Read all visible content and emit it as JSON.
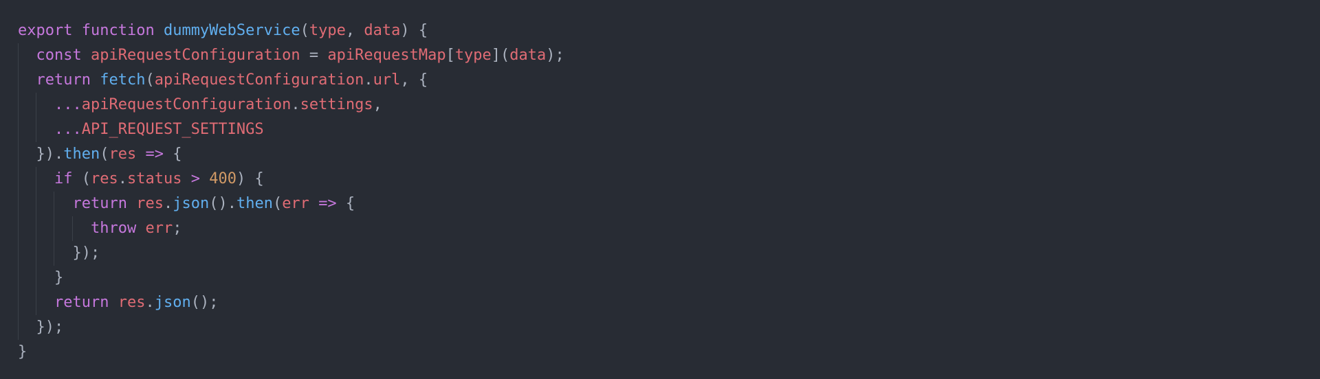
{
  "theme": {
    "background": "#282c34",
    "keyword": "#c678dd",
    "function": "#61afef",
    "variable": "#e06c75",
    "number": "#d19a66",
    "punctuation": "#abb2bf",
    "indent_guide": "#3b4048"
  },
  "code": {
    "lines": [
      {
        "indent": 0,
        "tokens": [
          {
            "t": "export",
            "c": "keyword"
          },
          {
            "t": " ",
            "c": "punct"
          },
          {
            "t": "function",
            "c": "keyword"
          },
          {
            "t": " ",
            "c": "punct"
          },
          {
            "t": "dummyWebService",
            "c": "function"
          },
          {
            "t": "(",
            "c": "punct"
          },
          {
            "t": "type",
            "c": "variable"
          },
          {
            "t": ", ",
            "c": "punct"
          },
          {
            "t": "data",
            "c": "variable"
          },
          {
            "t": ") {",
            "c": "punct"
          }
        ]
      },
      {
        "indent": 1,
        "tokens": [
          {
            "t": "const",
            "c": "keyword"
          },
          {
            "t": " ",
            "c": "punct"
          },
          {
            "t": "apiRequestConfiguration",
            "c": "variable"
          },
          {
            "t": " = ",
            "c": "punct"
          },
          {
            "t": "apiRequestMap",
            "c": "variable"
          },
          {
            "t": "[",
            "c": "punct"
          },
          {
            "t": "type",
            "c": "variable"
          },
          {
            "t": "](",
            "c": "punct"
          },
          {
            "t": "data",
            "c": "variable"
          },
          {
            "t": ");",
            "c": "punct"
          }
        ]
      },
      {
        "indent": 1,
        "tokens": [
          {
            "t": "return",
            "c": "keyword"
          },
          {
            "t": " ",
            "c": "punct"
          },
          {
            "t": "fetch",
            "c": "function"
          },
          {
            "t": "(",
            "c": "punct"
          },
          {
            "t": "apiRequestConfiguration",
            "c": "variable"
          },
          {
            "t": ".",
            "c": "punct"
          },
          {
            "t": "url",
            "c": "variable"
          },
          {
            "t": ", {",
            "c": "punct"
          }
        ]
      },
      {
        "indent": 2,
        "tokens": [
          {
            "t": "...",
            "c": "keyword"
          },
          {
            "t": "apiRequestConfiguration",
            "c": "variable"
          },
          {
            "t": ".",
            "c": "punct"
          },
          {
            "t": "settings",
            "c": "variable"
          },
          {
            "t": ",",
            "c": "punct"
          }
        ]
      },
      {
        "indent": 2,
        "tokens": [
          {
            "t": "...",
            "c": "keyword"
          },
          {
            "t": "API_REQUEST_SETTINGS",
            "c": "variable"
          }
        ]
      },
      {
        "indent": 1,
        "tokens": [
          {
            "t": "})",
            "c": "punct"
          },
          {
            "t": ".",
            "c": "punct"
          },
          {
            "t": "then",
            "c": "function"
          },
          {
            "t": "(",
            "c": "punct"
          },
          {
            "t": "res",
            "c": "variable"
          },
          {
            "t": " ",
            "c": "punct"
          },
          {
            "t": "=>",
            "c": "operator"
          },
          {
            "t": " {",
            "c": "punct"
          }
        ]
      },
      {
        "indent": 2,
        "tokens": [
          {
            "t": "if",
            "c": "keyword"
          },
          {
            "t": " (",
            "c": "punct"
          },
          {
            "t": "res",
            "c": "variable"
          },
          {
            "t": ".",
            "c": "punct"
          },
          {
            "t": "status",
            "c": "variable"
          },
          {
            "t": " ",
            "c": "punct"
          },
          {
            "t": ">",
            "c": "operator"
          },
          {
            "t": " ",
            "c": "punct"
          },
          {
            "t": "400",
            "c": "number"
          },
          {
            "t": ") {",
            "c": "punct"
          }
        ]
      },
      {
        "indent": 3,
        "tokens": [
          {
            "t": "return",
            "c": "keyword"
          },
          {
            "t": " ",
            "c": "punct"
          },
          {
            "t": "res",
            "c": "variable"
          },
          {
            "t": ".",
            "c": "punct"
          },
          {
            "t": "json",
            "c": "function"
          },
          {
            "t": "()",
            "c": "punct"
          },
          {
            "t": ".",
            "c": "punct"
          },
          {
            "t": "then",
            "c": "function"
          },
          {
            "t": "(",
            "c": "punct"
          },
          {
            "t": "err",
            "c": "variable"
          },
          {
            "t": " ",
            "c": "punct"
          },
          {
            "t": "=>",
            "c": "operator"
          },
          {
            "t": " {",
            "c": "punct"
          }
        ]
      },
      {
        "indent": 4,
        "tokens": [
          {
            "t": "throw",
            "c": "keyword"
          },
          {
            "t": " ",
            "c": "punct"
          },
          {
            "t": "err",
            "c": "variable"
          },
          {
            "t": ";",
            "c": "punct"
          }
        ]
      },
      {
        "indent": 3,
        "tokens": [
          {
            "t": "});",
            "c": "punct"
          }
        ]
      },
      {
        "indent": 2,
        "tokens": [
          {
            "t": "}",
            "c": "punct"
          }
        ]
      },
      {
        "indent": 2,
        "tokens": [
          {
            "t": "return",
            "c": "keyword"
          },
          {
            "t": " ",
            "c": "punct"
          },
          {
            "t": "res",
            "c": "variable"
          },
          {
            "t": ".",
            "c": "punct"
          },
          {
            "t": "json",
            "c": "function"
          },
          {
            "t": "();",
            "c": "punct"
          }
        ]
      },
      {
        "indent": 1,
        "tokens": [
          {
            "t": "});",
            "c": "punct"
          }
        ]
      },
      {
        "indent": 0,
        "tokens": [
          {
            "t": "}",
            "c": "punct"
          }
        ]
      }
    ]
  }
}
